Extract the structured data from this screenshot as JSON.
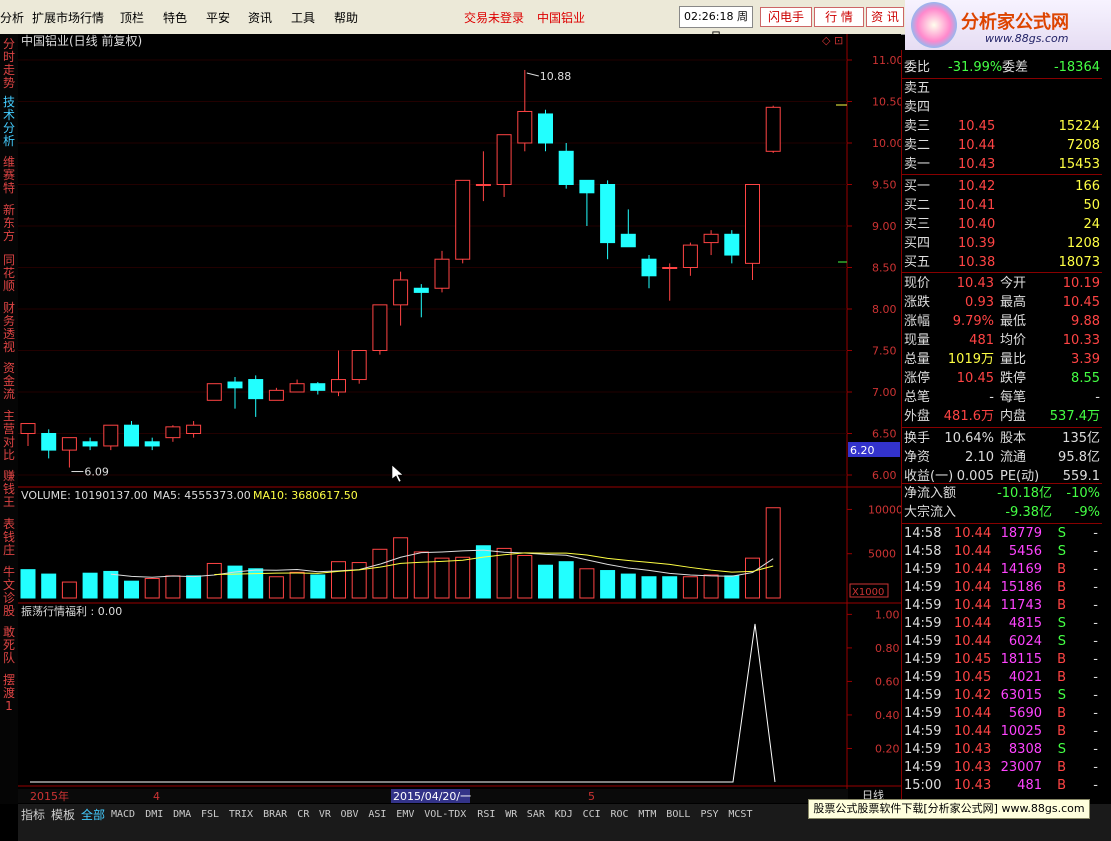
{
  "menu": {
    "items": [
      "分析",
      "扩展市场行情",
      "顶栏",
      "特色",
      "平安",
      "资讯",
      "工具",
      "帮助"
    ],
    "login_status": "交易未登录",
    "stock_name": "中国铝业",
    "time": "02:26:18 周日",
    "btn_flash": "闪电手",
    "btn_market": "行 情",
    "btn_info": "资 讯"
  },
  "logo": {
    "title": "分析家公式网",
    "url": "www.88gs.com"
  },
  "left_tabs": [
    "分时走势",
    "技术分析",
    "维赛特",
    "新东方",
    "同花顺",
    "财务透视",
    "资金流",
    "主营对比",
    "赚钱王",
    "表钱庄",
    "牛文诊股",
    "敢死队",
    "摆渡1"
  ],
  "chart": {
    "title": "中国铝业(日线 前复权)",
    "high_label": "10.88",
    "low_label": "6.09",
    "price_box": "6.20"
  },
  "volume": {
    "label": "VOLUME: 10190137.00",
    "ma5": "MA5: 4555373.00",
    "ma10": "MA10: 3680617.50",
    "unit": "X1000"
  },
  "indicator": {
    "label": "振荡行情福利 : 0.00"
  },
  "timeline": {
    "year": "2015年",
    "m4": "4",
    "cursor": "2015/04/20/一",
    "m5": "5",
    "period": "日线"
  },
  "chart_data": [
    {
      "type": "candlestick",
      "title": "中国铝业(日线 前复权)",
      "ylim": [
        6.0,
        11.0
      ],
      "yticks": [
        6.0,
        6.5,
        7.0,
        7.5,
        8.0,
        8.5,
        9.0,
        9.5,
        10.0,
        10.5,
        11.0
      ],
      "ohlc": [
        [
          6.5,
          6.6,
          6.35,
          6.62
        ],
        [
          6.5,
          6.55,
          6.2,
          6.3
        ],
        [
          6.3,
          6.45,
          6.09,
          6.45
        ],
        [
          6.4,
          6.45,
          6.3,
          6.35
        ],
        [
          6.35,
          6.6,
          6.3,
          6.6
        ],
        [
          6.6,
          6.65,
          6.35,
          6.35
        ],
        [
          6.4,
          6.45,
          6.3,
          6.35
        ],
        [
          6.45,
          6.6,
          6.4,
          6.58
        ],
        [
          6.5,
          6.65,
          6.45,
          6.6
        ],
        [
          6.9,
          7.1,
          6.9,
          7.1
        ],
        [
          7.12,
          7.18,
          6.8,
          7.05
        ],
        [
          7.15,
          7.2,
          6.7,
          6.92
        ],
        [
          6.9,
          7.05,
          6.9,
          7.02
        ],
        [
          7.0,
          7.15,
          7.0,
          7.1
        ],
        [
          7.1,
          7.12,
          6.97,
          7.02
        ],
        [
          7.0,
          7.5,
          6.95,
          7.15
        ],
        [
          7.15,
          7.5,
          7.1,
          7.5
        ],
        [
          7.5,
          8.05,
          7.45,
          8.05
        ],
        [
          8.05,
          8.45,
          7.8,
          8.35
        ],
        [
          8.25,
          8.3,
          7.9,
          8.2
        ],
        [
          8.25,
          8.7,
          8.2,
          8.6
        ],
        [
          8.6,
          9.55,
          8.55,
          9.55
        ],
        [
          9.5,
          9.9,
          9.3,
          9.5
        ],
        [
          9.5,
          10.1,
          9.35,
          10.1
        ],
        [
          10.0,
          10.88,
          9.9,
          10.38
        ],
        [
          10.35,
          10.4,
          9.9,
          10.0
        ],
        [
          9.9,
          10.0,
          9.45,
          9.5
        ],
        [
          9.55,
          9.55,
          9.0,
          9.4
        ],
        [
          9.5,
          9.55,
          8.6,
          8.8
        ],
        [
          8.9,
          9.2,
          8.8,
          8.75
        ],
        [
          8.6,
          8.65,
          8.25,
          8.4
        ],
        [
          8.5,
          8.55,
          8.1,
          8.5
        ],
        [
          8.5,
          8.8,
          8.4,
          8.77
        ],
        [
          8.8,
          8.95,
          8.65,
          8.9
        ],
        [
          8.9,
          8.95,
          8.55,
          8.65
        ],
        [
          8.55,
          9.5,
          8.35,
          9.5
        ],
        [
          9.9,
          10.45,
          9.88,
          10.43
        ]
      ]
    },
    {
      "type": "bar",
      "title": "VOLUME",
      "ylim": [
        0,
        10500
      ],
      "yticks": [
        5000,
        10000
      ],
      "values": [
        3200,
        2700,
        1800,
        2800,
        3000,
        1900,
        2200,
        2500,
        2500,
        3900,
        3600,
        3300,
        2400,
        2900,
        2600,
        4100,
        4000,
        5500,
        6800,
        5200,
        4500,
        4600,
        5900,
        5600,
        4800,
        3700,
        4100,
        3300,
        3100,
        2700,
        2400,
        2400,
        2400,
        2600,
        2500,
        4500,
        10190
      ],
      "up": [
        false,
        false,
        true,
        false,
        false,
        false,
        true,
        true,
        false,
        true,
        false,
        false,
        true,
        true,
        false,
        true,
        true,
        true,
        true,
        true,
        true,
        true,
        false,
        true,
        true,
        false,
        false,
        true,
        false,
        false,
        false,
        false,
        true,
        true,
        false,
        true,
        true
      ]
    },
    {
      "type": "line",
      "title": "振荡行情福利",
      "ylim": [
        0,
        1.05
      ],
      "yticks": [
        0.2,
        0.4,
        0.6,
        0.8,
        1.0
      ]
    }
  ],
  "quote": {
    "weibi": {
      "label": "委比",
      "value": "-31.99%",
      "label2": "委差",
      "value2": "-18364"
    },
    "sells": [
      {
        "label": "卖五",
        "price": "",
        "vol": ""
      },
      {
        "label": "卖四",
        "price": "",
        "vol": ""
      },
      {
        "label": "卖三",
        "price": "10.45",
        "vol": "15224"
      },
      {
        "label": "卖二",
        "price": "10.44",
        "vol": "7208"
      },
      {
        "label": "卖一",
        "price": "10.43",
        "vol": "15453"
      }
    ],
    "buys": [
      {
        "label": "买一",
        "price": "10.42",
        "vol": "166"
      },
      {
        "label": "买二",
        "price": "10.41",
        "vol": "50"
      },
      {
        "label": "买三",
        "price": "10.40",
        "vol": "24"
      },
      {
        "label": "买四",
        "price": "10.39",
        "vol": "1208"
      },
      {
        "label": "买五",
        "price": "10.38",
        "vol": "18073"
      }
    ],
    "stats": [
      {
        "l1": "现价",
        "v1": "10.43",
        "l2": "今开",
        "v2": "10.19",
        "c1": "#f44",
        "c2": "#f44"
      },
      {
        "l1": "涨跌",
        "v1": "0.93",
        "l2": "最高",
        "v2": "10.45",
        "c1": "#f44",
        "c2": "#f44"
      },
      {
        "l1": "涨幅",
        "v1": "9.79%",
        "l2": "最低",
        "v2": "9.88",
        "c1": "#f44",
        "c2": "#f44"
      },
      {
        "l1": "现量",
        "v1": "481",
        "l2": "均价",
        "v2": "10.33",
        "c1": "#f44",
        "c2": "#f44"
      },
      {
        "l1": "总量",
        "v1": "1019万",
        "l2": "量比",
        "v2": "3.39",
        "c1": "#ff4",
        "c2": "#f44"
      },
      {
        "l1": "涨停",
        "v1": "10.45",
        "l2": "跌停",
        "v2": "8.55",
        "c1": "#f44",
        "c2": "#4f4"
      },
      {
        "l1": "总笔",
        "v1": "-",
        "l2": "每笔",
        "v2": "-",
        "c1": "#ddd",
        "c2": "#ddd"
      },
      {
        "l1": "外盘",
        "v1": "481.6万",
        "l2": "内盘",
        "v2": "537.4万",
        "c1": "#f44",
        "c2": "#4f4"
      },
      {
        "l1": "换手",
        "v1": "10.64%",
        "l2": "股本",
        "v2": "135亿",
        "c1": "#ddd",
        "c2": "#ddd"
      },
      {
        "l1": "净资",
        "v1": "2.10",
        "l2": "流通",
        "v2": "95.8亿",
        "c1": "#ddd",
        "c2": "#ddd"
      },
      {
        "l1": "收益(一)",
        "v1": "0.005",
        "l2": "PE(动)",
        "v2": "559.1",
        "c1": "#ddd",
        "c2": "#ddd"
      }
    ],
    "flows": [
      {
        "label": "净流入额",
        "value": "-10.18亿",
        "pct": "-10%"
      },
      {
        "label": "大宗流入",
        "value": "-9.38亿",
        "pct": "-9%"
      }
    ],
    "ticks": [
      {
        "t": "14:58",
        "p": "10.44",
        "v": "18779",
        "d": "S"
      },
      {
        "t": "14:58",
        "p": "10.44",
        "v": "5456",
        "d": "S"
      },
      {
        "t": "14:59",
        "p": "10.44",
        "v": "14169",
        "d": "B"
      },
      {
        "t": "14:59",
        "p": "10.44",
        "v": "15186",
        "d": "B"
      },
      {
        "t": "14:59",
        "p": "10.44",
        "v": "11743",
        "d": "B"
      },
      {
        "t": "14:59",
        "p": "10.44",
        "v": "4815",
        "d": "S"
      },
      {
        "t": "14:59",
        "p": "10.44",
        "v": "6024",
        "d": "S"
      },
      {
        "t": "14:59",
        "p": "10.45",
        "v": "18115",
        "d": "B"
      },
      {
        "t": "14:59",
        "p": "10.45",
        "v": "4021",
        "d": "B"
      },
      {
        "t": "14:59",
        "p": "10.42",
        "v": "63015",
        "d": "S"
      },
      {
        "t": "14:59",
        "p": "10.44",
        "v": "5690",
        "d": "B"
      },
      {
        "t": "14:59",
        "p": "10.44",
        "v": "10025",
        "d": "B"
      },
      {
        "t": "14:59",
        "p": "10.43",
        "v": "8308",
        "d": "S"
      },
      {
        "t": "14:59",
        "p": "10.43",
        "v": "23007",
        "d": "B"
      },
      {
        "t": "15:00",
        "p": "10.43",
        "v": "481",
        "d": "B"
      }
    ]
  },
  "bottom_tabs": [
    "指标",
    "模板",
    "全部",
    "MACD",
    "DMI",
    "DMA",
    "FSL",
    "TRIX",
    "BRAR",
    "CR",
    "VR",
    "OBV",
    "ASI",
    "EMV",
    "VOL-TDX",
    "RSI",
    "WR",
    "SAR",
    "KDJ",
    "CCI",
    "ROC",
    "MTM",
    "BOLL",
    "PSY",
    "MCST"
  ],
  "ad": {
    "text": "股票公式股票软件下载[分析家公式网]",
    "url": "www.88gs.com"
  }
}
